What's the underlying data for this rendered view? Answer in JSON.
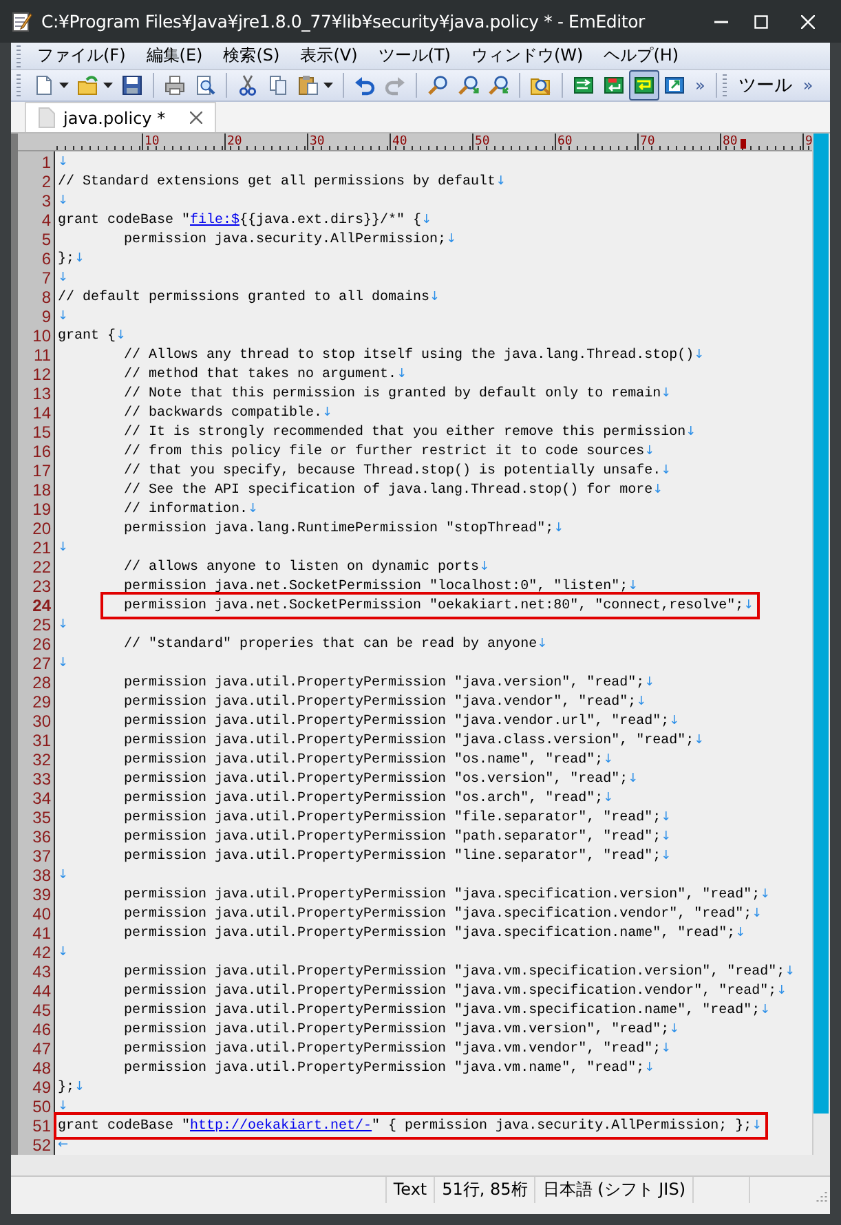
{
  "window": {
    "title": "C:¥Program Files¥Java¥jre1.8.0_77¥lib¥security¥java.policy * - EmEditor"
  },
  "menu": [
    "ファイル(F)",
    "編集(E)",
    "検索(S)",
    "表示(V)",
    "ツール(T)",
    "ウィンドウ(W)",
    "ヘルプ(H)"
  ],
  "toolbar": {
    "groups": [
      [
        {
          "kind": "new",
          "dropdown": true,
          "disabled": false,
          "pressed": false
        },
        {
          "kind": "open",
          "dropdown": true,
          "disabled": false,
          "pressed": false
        },
        {
          "kind": "save",
          "dropdown": false,
          "disabled": false,
          "pressed": false
        }
      ],
      [
        {
          "kind": "print",
          "dropdown": false,
          "disabled": false,
          "pressed": false
        },
        {
          "kind": "preview",
          "dropdown": false,
          "disabled": false,
          "pressed": false
        }
      ],
      [
        {
          "kind": "cut",
          "dropdown": false,
          "disabled": false,
          "pressed": false
        },
        {
          "kind": "copy",
          "dropdown": false,
          "disabled": false,
          "pressed": false
        },
        {
          "kind": "paste",
          "dropdown": true,
          "disabled": false,
          "pressed": false
        }
      ],
      [
        {
          "kind": "undo",
          "dropdown": false,
          "disabled": false,
          "pressed": false
        },
        {
          "kind": "redo",
          "dropdown": false,
          "disabled": true,
          "pressed": false
        }
      ],
      [
        {
          "kind": "find",
          "dropdown": false,
          "disabled": false,
          "pressed": false
        },
        {
          "kind": "findnext",
          "dropdown": false,
          "disabled": false,
          "pressed": false
        },
        {
          "kind": "findprev",
          "dropdown": false,
          "disabled": false,
          "pressed": false
        }
      ],
      [
        {
          "kind": "findfiles",
          "dropdown": false,
          "disabled": false,
          "pressed": false
        }
      ],
      [
        {
          "kind": "lines",
          "dropdown": false,
          "disabled": false,
          "pressed": false
        },
        {
          "kind": "wrapchars",
          "dropdown": false,
          "disabled": false,
          "pressed": false
        },
        {
          "kind": "wrapwindow",
          "dropdown": false,
          "disabled": false,
          "pressed": true
        },
        {
          "kind": "wrappage",
          "dropdown": false,
          "disabled": false,
          "pressed": false
        }
      ]
    ],
    "overflow": "»"
  },
  "tools_toolbar": {
    "label": "ツール",
    "overflow": "»"
  },
  "tabs": [
    {
      "label": "java.policy *",
      "selected": true
    }
  ],
  "ruler": [
    "10",
    "20",
    "30",
    "40",
    "50",
    "60",
    "70",
    "80",
    "9"
  ],
  "lines": [
    {
      "number": "1",
      "eol": "↓",
      "current": false,
      "boxed": false
    },
    {
      "number": "2",
      "text": "// Standard extensions get all permissions by default",
      "eol": "↓",
      "current": false,
      "boxed": false
    },
    {
      "number": "3",
      "eol": "↓",
      "current": false,
      "boxed": false
    },
    {
      "number": "4",
      "segments": [
        {
          "kind": "code",
          "text": "grant codeBase \""
        },
        {
          "kind": "link",
          "text": "file:$"
        },
        {
          "kind": "code",
          "text": "{{java.ext.dirs}}/*\" {"
        }
      ],
      "eol": "↓",
      "current": false,
      "boxed": false
    },
    {
      "number": "5",
      "text": "\tpermission java.security.AllPermission;",
      "eol": "↓",
      "current": false,
      "boxed": false
    },
    {
      "number": "6",
      "text": "};",
      "eol": "↓",
      "current": false,
      "boxed": false
    },
    {
      "number": "7",
      "eol": "↓",
      "current": false,
      "boxed": false
    },
    {
      "number": "8",
      "text": "// default permissions granted to all domains",
      "eol": "↓",
      "current": false,
      "boxed": false
    },
    {
      "number": "9",
      "eol": "↓",
      "current": false,
      "boxed": false
    },
    {
      "number": "10",
      "text": "grant {",
      "eol": "↓",
      "current": false,
      "boxed": false
    },
    {
      "number": "11",
      "text": "\t// Allows any thread to stop itself using the java.lang.Thread.stop()",
      "eol": "↓",
      "current": false,
      "boxed": false
    },
    {
      "number": "12",
      "text": "\t// method that takes no argument.",
      "eol": "↓",
      "current": false,
      "boxed": false
    },
    {
      "number": "13",
      "text": "\t// Note that this permission is granted by default only to remain",
      "eol": "↓",
      "current": false,
      "boxed": false
    },
    {
      "number": "14",
      "text": "\t// backwards compatible.",
      "eol": "↓",
      "current": false,
      "boxed": false
    },
    {
      "number": "15",
      "text": "\t// It is strongly recommended that you either remove this permission",
      "eol": "↓",
      "current": false,
      "boxed": false
    },
    {
      "number": "16",
      "text": "\t// from this policy file or further restrict it to code sources",
      "eol": "↓",
      "current": false,
      "boxed": false
    },
    {
      "number": "17",
      "text": "\t// that you specify, because Thread.stop() is potentially unsafe.",
      "eol": "↓",
      "current": false,
      "boxed": false
    },
    {
      "number": "18",
      "text": "\t// See the API specification of java.lang.Thread.stop() for more",
      "eol": "↓",
      "current": false,
      "boxed": false
    },
    {
      "number": "19",
      "text": "\t// information.",
      "eol": "↓",
      "current": false,
      "boxed": false
    },
    {
      "number": "20",
      "text": "\tpermission java.lang.RuntimePermission \"stopThread\";",
      "eol": "↓",
      "current": false,
      "boxed": false
    },
    {
      "number": "21",
      "eol": "↓",
      "current": false,
      "boxed": false
    },
    {
      "number": "22",
      "text": "\t// allows anyone to listen on dynamic ports",
      "eol": "↓",
      "current": false,
      "boxed": false
    },
    {
      "number": "23",
      "text": "\tpermission java.net.SocketPermission \"localhost:0\", \"listen\";",
      "eol": "↓",
      "current": false,
      "boxed": false
    },
    {
      "number": "24",
      "text": "\tpermission java.net.SocketPermission \"oekakiart.net:80\", \"connect,resolve\";",
      "eol": "↓",
      "current": true,
      "boxed": true
    },
    {
      "number": "25",
      "eol": "↓",
      "current": false,
      "boxed": false
    },
    {
      "number": "26",
      "text": "\t// \"standard\" properies that can be read by anyone",
      "eol": "↓",
      "current": false,
      "boxed": false
    },
    {
      "number": "27",
      "eol": "↓",
      "current": false,
      "boxed": false
    },
    {
      "number": "28",
      "text": "\tpermission java.util.PropertyPermission \"java.version\", \"read\";",
      "eol": "↓",
      "current": false,
      "boxed": false
    },
    {
      "number": "29",
      "text": "\tpermission java.util.PropertyPermission \"java.vendor\", \"read\";",
      "eol": "↓",
      "current": false,
      "boxed": false
    },
    {
      "number": "30",
      "text": "\tpermission java.util.PropertyPermission \"java.vendor.url\", \"read\";",
      "eol": "↓",
      "current": false,
      "boxed": false
    },
    {
      "number": "31",
      "text": "\tpermission java.util.PropertyPermission \"java.class.version\", \"read\";",
      "eol": "↓",
      "current": false,
      "boxed": false
    },
    {
      "number": "32",
      "text": "\tpermission java.util.PropertyPermission \"os.name\", \"read\";",
      "eol": "↓",
      "current": false,
      "boxed": false
    },
    {
      "number": "33",
      "text": "\tpermission java.util.PropertyPermission \"os.version\", \"read\";",
      "eol": "↓",
      "current": false,
      "boxed": false
    },
    {
      "number": "34",
      "text": "\tpermission java.util.PropertyPermission \"os.arch\", \"read\";",
      "eol": "↓",
      "current": false,
      "boxed": false
    },
    {
      "number": "35",
      "text": "\tpermission java.util.PropertyPermission \"file.separator\", \"read\";",
      "eol": "↓",
      "current": false,
      "boxed": false
    },
    {
      "number": "36",
      "text": "\tpermission java.util.PropertyPermission \"path.separator\", \"read\";",
      "eol": "↓",
      "current": false,
      "boxed": false
    },
    {
      "number": "37",
      "text": "\tpermission java.util.PropertyPermission \"line.separator\", \"read\";",
      "eol": "↓",
      "current": false,
      "boxed": false
    },
    {
      "number": "38",
      "eol": "↓",
      "current": false,
      "boxed": false
    },
    {
      "number": "39",
      "text": "\tpermission java.util.PropertyPermission \"java.specification.version\", \"read\";",
      "eol": "↓",
      "current": false,
      "boxed": false
    },
    {
      "number": "40",
      "text": "\tpermission java.util.PropertyPermission \"java.specification.vendor\", \"read\";",
      "eol": "↓",
      "current": false,
      "boxed": false
    },
    {
      "number": "41",
      "text": "\tpermission java.util.PropertyPermission \"java.specification.name\", \"read\";",
      "eol": "↓",
      "current": false,
      "boxed": false
    },
    {
      "number": "42",
      "eol": "↓",
      "current": false,
      "boxed": false
    },
    {
      "number": "43",
      "text": "\tpermission java.util.PropertyPermission \"java.vm.specification.version\", \"read\";",
      "eol": "↓",
      "current": false,
      "boxed": false
    },
    {
      "number": "44",
      "text": "\tpermission java.util.PropertyPermission \"java.vm.specification.vendor\", \"read\";",
      "eol": "↓",
      "current": false,
      "boxed": false
    },
    {
      "number": "45",
      "text": "\tpermission java.util.PropertyPermission \"java.vm.specification.name\", \"read\";",
      "eol": "↓",
      "current": false,
      "boxed": false
    },
    {
      "number": "46",
      "text": "\tpermission java.util.PropertyPermission \"java.vm.version\", \"read\";",
      "eol": "↓",
      "current": false,
      "boxed": false
    },
    {
      "number": "47",
      "text": "\tpermission java.util.PropertyPermission \"java.vm.vendor\", \"read\";",
      "eol": "↓",
      "current": false,
      "boxed": false
    },
    {
      "number": "48",
      "text": "\tpermission java.util.PropertyPermission \"java.vm.name\", \"read\";",
      "eol": "↓",
      "current": false,
      "boxed": false
    },
    {
      "number": "49",
      "text": "};",
      "eol": "↓",
      "current": false,
      "boxed": false
    },
    {
      "number": "50",
      "eol": "↓",
      "current": false,
      "boxed": false
    },
    {
      "number": "51",
      "segments": [
        {
          "kind": "code",
          "text": "grant codeBase \""
        },
        {
          "kind": "link",
          "text": "http://oekakiart.net/-"
        },
        {
          "kind": "code",
          "text": "\" { permission java.security.AllPermission; };"
        }
      ],
      "eol": "↓",
      "current": false,
      "boxed": true
    },
    {
      "number": "52",
      "eol": "←",
      "current": false,
      "boxed": false
    }
  ],
  "status_bar": [
    "Text",
    "51行, 85桁",
    "日本語 (シフト JIS)"
  ]
}
